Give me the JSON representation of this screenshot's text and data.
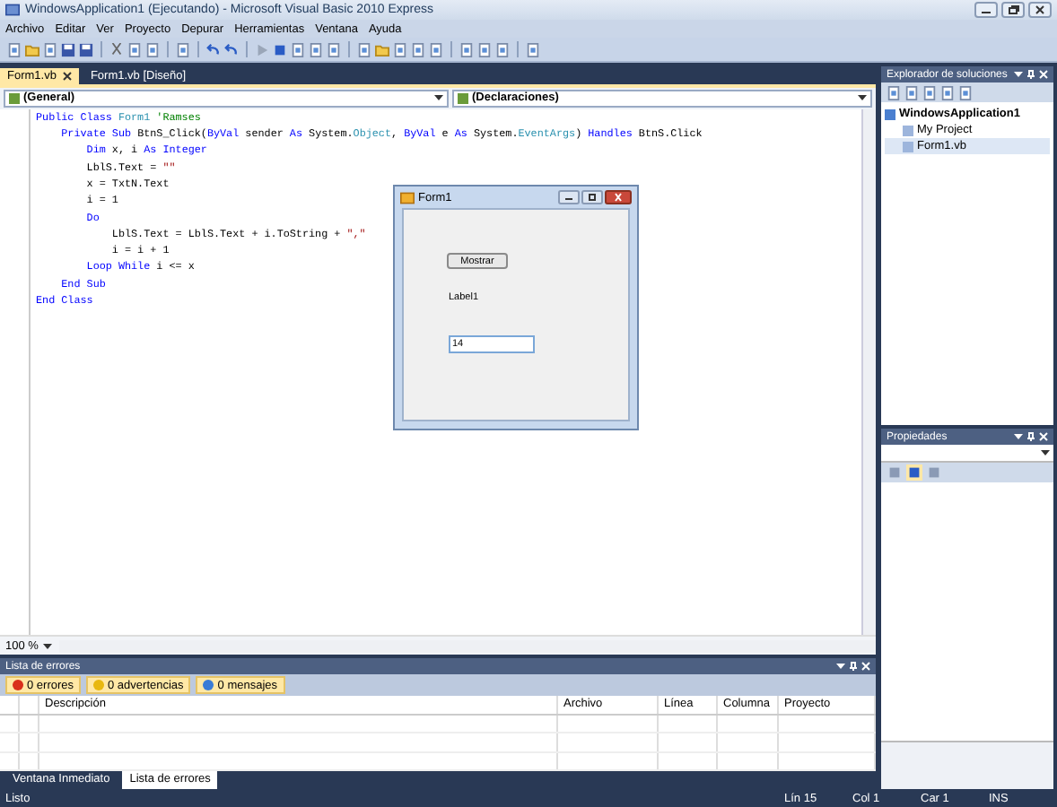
{
  "window": {
    "title": "WindowsApplication1 (Ejecutando) - Microsoft Visual Basic 2010 Express"
  },
  "menu": [
    "Archivo",
    "Editar",
    "Ver",
    "Proyecto",
    "Depurar",
    "Herramientas",
    "Ventana",
    "Ayuda"
  ],
  "doc_tabs": [
    {
      "label": "Form1.vb",
      "selected": true
    },
    {
      "label": "Form1.vb [Diseño]",
      "selected": false
    }
  ],
  "editor": {
    "class_dropdown": "(General)",
    "member_dropdown": "(Declaraciones)",
    "zoom": "100 %",
    "lines": [
      [
        {
          "text": "Public Class",
          "kind": "keyword"
        },
        {
          "text": " Form1 ",
          "kind": "type"
        },
        {
          "text": "'Ramses",
          "kind": "comment"
        }
      ],
      [
        {
          "text": "    Private Sub",
          "kind": "keyword"
        },
        {
          "text": " BtnS_Click(",
          "kind": "plain"
        },
        {
          "text": "ByVal",
          "kind": "keyword"
        },
        {
          "text": " sender ",
          "kind": "plain"
        },
        {
          "text": "As",
          "kind": "keyword"
        },
        {
          "text": " System.",
          "kind": "plain"
        },
        {
          "text": "Object",
          "kind": "type"
        },
        {
          "text": ", ",
          "kind": "plain"
        },
        {
          "text": "ByVal",
          "kind": "keyword"
        },
        {
          "text": " e ",
          "kind": "plain"
        },
        {
          "text": "As",
          "kind": "keyword"
        },
        {
          "text": " System.",
          "kind": "plain"
        },
        {
          "text": "EventArgs",
          "kind": "type"
        },
        {
          "text": ") ",
          "kind": "plain"
        },
        {
          "text": "Handles",
          "kind": "keyword"
        },
        {
          "text": " BtnS.Click",
          "kind": "plain"
        }
      ],
      [
        {
          "text": "        Dim",
          "kind": "keyword"
        },
        {
          "text": " x, i ",
          "kind": "plain"
        },
        {
          "text": "As Integer",
          "kind": "keyword"
        }
      ],
      [
        {
          "text": "        LblS.Text = ",
          "kind": "plain"
        },
        {
          "text": "\"\"",
          "kind": "string"
        }
      ],
      [
        {
          "text": "        x = TxtN.Text",
          "kind": "plain"
        }
      ],
      [
        {
          "text": "        i = 1",
          "kind": "plain"
        }
      ],
      [
        {
          "text": "        Do",
          "kind": "keyword"
        }
      ],
      [
        {
          "text": "            LblS.Text = LblS.Text + i.ToString + ",
          "kind": "plain"
        },
        {
          "text": "\",\"",
          "kind": "string"
        }
      ],
      [
        {
          "text": "            i = i + 1",
          "kind": "plain"
        }
      ],
      [
        {
          "text": "        Loop While",
          "kind": "keyword"
        },
        {
          "text": " i <= x",
          "kind": "plain"
        }
      ],
      [
        {
          "text": "    End Sub",
          "kind": "keyword"
        }
      ],
      [
        {
          "text": "End Class",
          "kind": "keyword"
        }
      ]
    ]
  },
  "form_window": {
    "title": "Form1",
    "button": "Mostrar",
    "label": "Label1",
    "textbox_value": "14"
  },
  "error_list": {
    "title": "Lista de errores",
    "filters": [
      {
        "label": "0 errores",
        "kind": "error",
        "selected": true
      },
      {
        "label": "0 advertencias",
        "kind": "warning",
        "selected": true
      },
      {
        "label": "0 mensajes",
        "kind": "info",
        "selected": true
      }
    ],
    "columns": [
      "Descripción",
      "Archivo",
      "Línea",
      "Columna",
      "Proyecto"
    ]
  },
  "bottom_tabs": [
    {
      "label": "Ventana Inmediato",
      "selected": false
    },
    {
      "label": "Lista de errores",
      "selected": true
    }
  ],
  "solution_explorer": {
    "title": "Explorador de soluciones",
    "tree": [
      {
        "label": "WindowsApplication1",
        "selected": false,
        "children": [
          {
            "label": "My Project",
            "selected": false
          },
          {
            "label": "Form1.vb",
            "selected": true
          }
        ]
      }
    ]
  },
  "properties": {
    "title": "Propiedades",
    "sort_buttons": [
      {
        "kind": "categorized",
        "selected": false
      },
      {
        "kind": "alphabetical",
        "selected": true
      },
      {
        "kind": "pages",
        "selected": false
      }
    ]
  },
  "status_bar": {
    "message": "Listo",
    "line": "Lín 15",
    "col": "Col 1",
    "char": "Car 1",
    "mode": "INS"
  }
}
